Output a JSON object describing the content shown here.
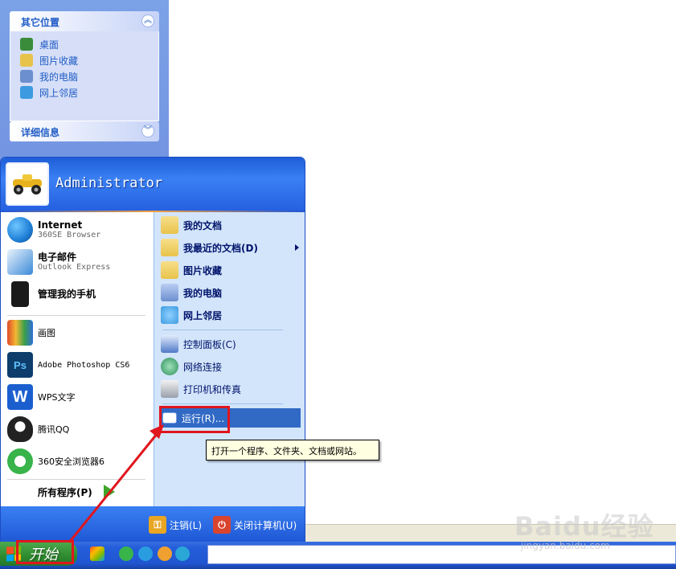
{
  "task_pane": {
    "other_places": {
      "title": "其它位置",
      "items": [
        {
          "label": "桌面",
          "icon": "desktop-icon",
          "color": "#3a8c3a"
        },
        {
          "label": "图片收藏",
          "icon": "pictures-folder-icon",
          "color": "#e8c34b"
        },
        {
          "label": "我的电脑",
          "icon": "my-computer-icon",
          "color": "#6c8fcf"
        },
        {
          "label": "网上邻居",
          "icon": "network-icon",
          "color": "#3c9be0"
        }
      ]
    },
    "details": {
      "title": "详细信息"
    }
  },
  "start_menu": {
    "user_name": "Administrator",
    "left_items": [
      {
        "title": "Internet",
        "subtitle": "360SE Browser",
        "icon": "internet-globe-icon",
        "color": "#1f7fd6"
      },
      {
        "title": "电子邮件",
        "subtitle": "Outlook Express",
        "icon": "email-icon",
        "color": "#3b8ad8"
      },
      {
        "title": "管理我的手机",
        "subtitle": "",
        "icon": "phone-icon",
        "color": "#1a1a1a"
      },
      {
        "title": "画图",
        "icon": "paint-icon",
        "color": "#d86a2a"
      },
      {
        "title": "Adobe Photoshop CS6",
        "icon": "photoshop-icon",
        "glyph": "Ps",
        "color": "#0e3d6b"
      },
      {
        "title": "WPS文字",
        "icon": "wps-writer-icon",
        "glyph": "W",
        "color": "#1b5fcf"
      },
      {
        "title": "腾讯QQ",
        "icon": "qq-penguin-icon",
        "color": "#222222"
      },
      {
        "title": "360安全浏览器6",
        "icon": "360-browser-icon",
        "color": "#38b44a"
      }
    ],
    "all_programs": "所有程序(P)",
    "right_items": [
      {
        "label": "我的文档",
        "icon": "my-documents-icon",
        "color": "#e8c34b"
      },
      {
        "label": "我最近的文档(D)",
        "icon": "recent-documents-icon",
        "color": "#e8c34b"
      },
      {
        "label": "图片收藏",
        "icon": "my-pictures-icon",
        "color": "#e8c34b"
      },
      {
        "label": "我的电脑",
        "icon": "my-computer-icon",
        "color": "#6c8fcf"
      },
      {
        "label": "网上邻居",
        "icon": "network-places-icon",
        "color": "#3c9be0"
      },
      {
        "label": "控制面板(C)",
        "icon": "control-panel-icon",
        "color": "#4f79c9"
      },
      {
        "label": "网络连接",
        "icon": "network-connections-icon",
        "color": "#2d8f5c"
      },
      {
        "label": "打印机和传真",
        "icon": "printer-icon",
        "color": "#9aa0aa"
      },
      {
        "label": "运行(R)...",
        "icon": "run-icon",
        "color": "#ffffff"
      }
    ],
    "logoff": "注销(L)",
    "shutdown": "关闭计算机(U)"
  },
  "tooltip": "打开一个程序、文件夹、文档或网站。",
  "taskbar": {
    "start_label": "开始"
  },
  "watermark": {
    "logo": "Baidu经验",
    "url": "jingyan.baidu.com"
  },
  "colors": {
    "start_menu_blue": "#2560e0",
    "highlight": "#316ac5",
    "annotation_red": "#e0161e"
  }
}
